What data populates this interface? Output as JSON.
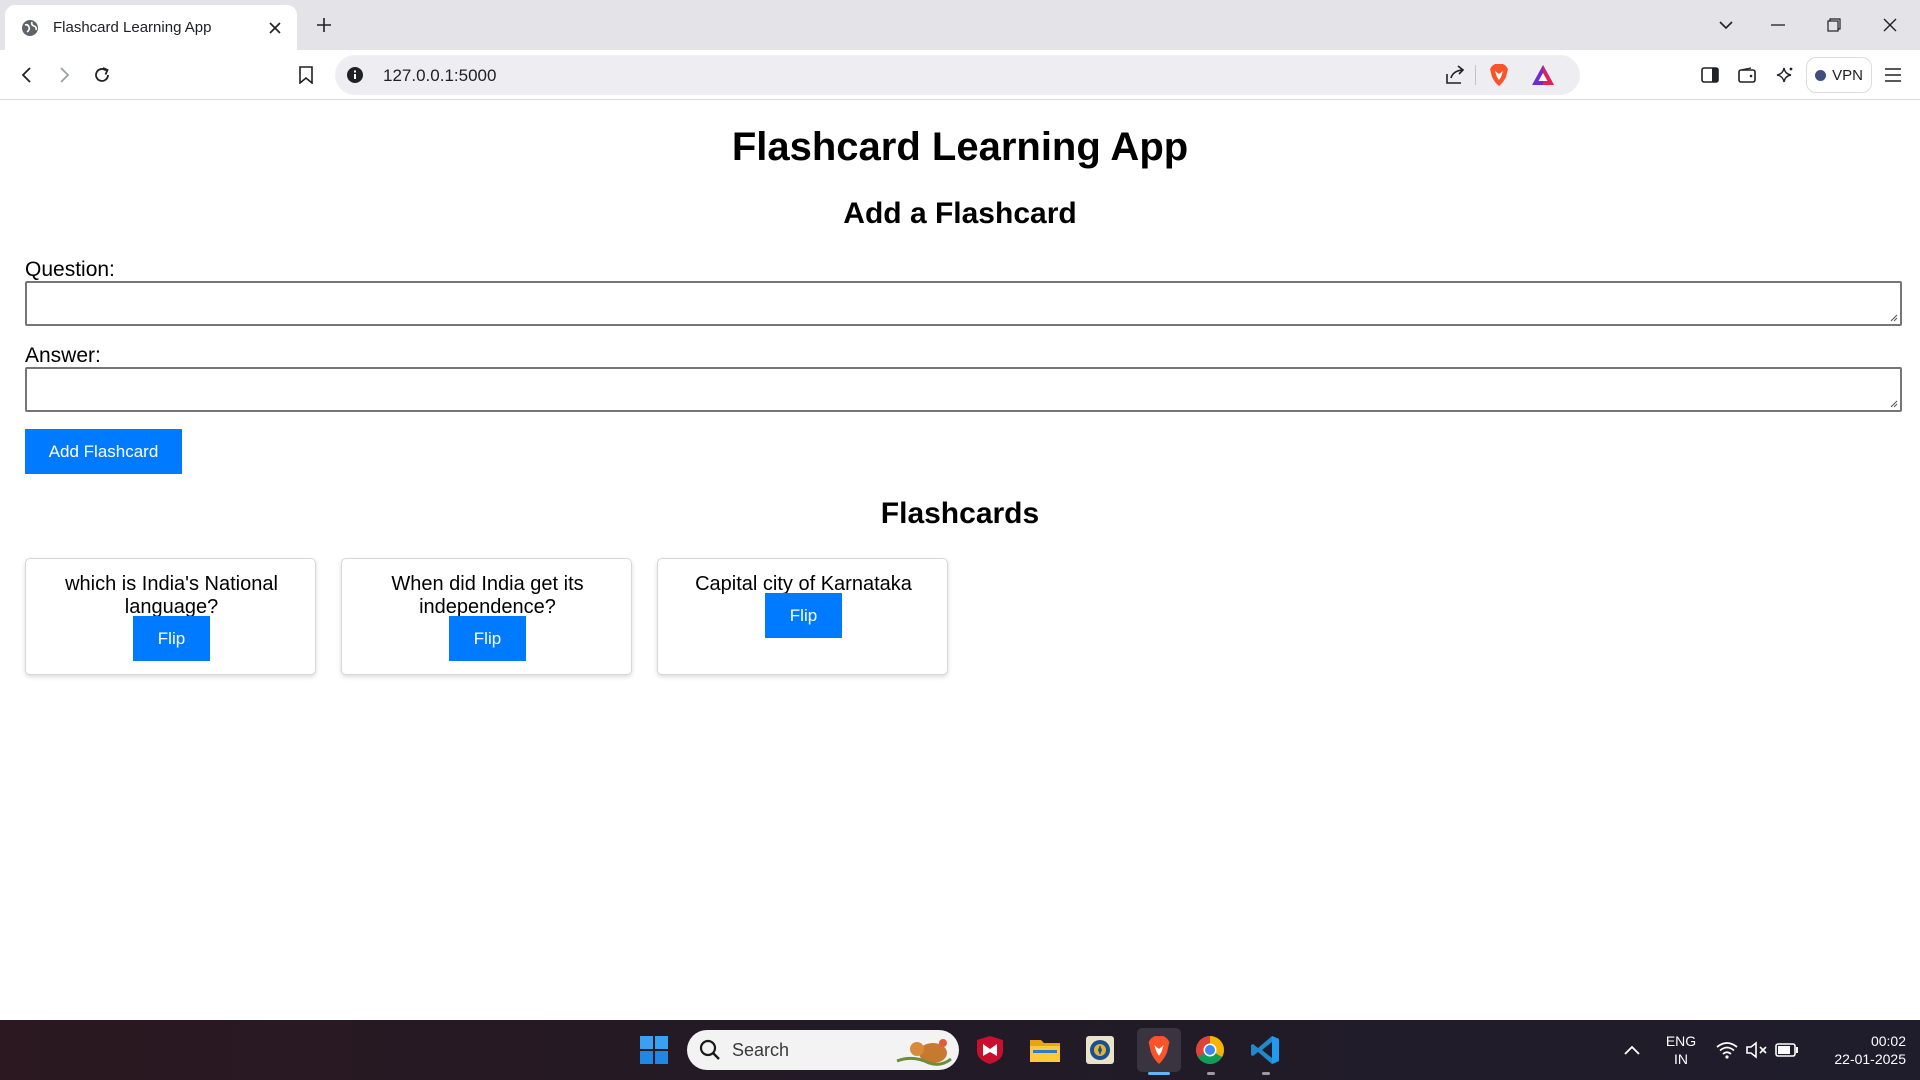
{
  "browser": {
    "tab_title": "Flashcard Learning App",
    "url": "127.0.0.1:5000",
    "vpn_label": "VPN"
  },
  "page": {
    "title": "Flashcard Learning App",
    "add_heading": "Add a Flashcard",
    "question_label": "Question:",
    "question_value": "",
    "answer_label": "Answer:",
    "answer_value": "",
    "add_button_label": "Add Flashcard",
    "list_heading": "Flashcards",
    "flashcards": [
      {
        "question": "which is India's National language?",
        "flip_label": "Flip"
      },
      {
        "question": "When did India get its independence?",
        "flip_label": "Flip"
      },
      {
        "question": "Capital city of Karnataka",
        "flip_label": "Flip"
      }
    ],
    "accent_color": "#007bff"
  },
  "taskbar": {
    "search_label": "Search",
    "language": "ENG",
    "region": "IN",
    "time": "00:02",
    "date": "22-01-2025",
    "pinned_apps": [
      "windows-start-icon",
      "mcafee-icon",
      "file-explorer-icon",
      "security-app-icon",
      "brave-browser-icon",
      "chrome-icon",
      "vscode-icon"
    ]
  }
}
